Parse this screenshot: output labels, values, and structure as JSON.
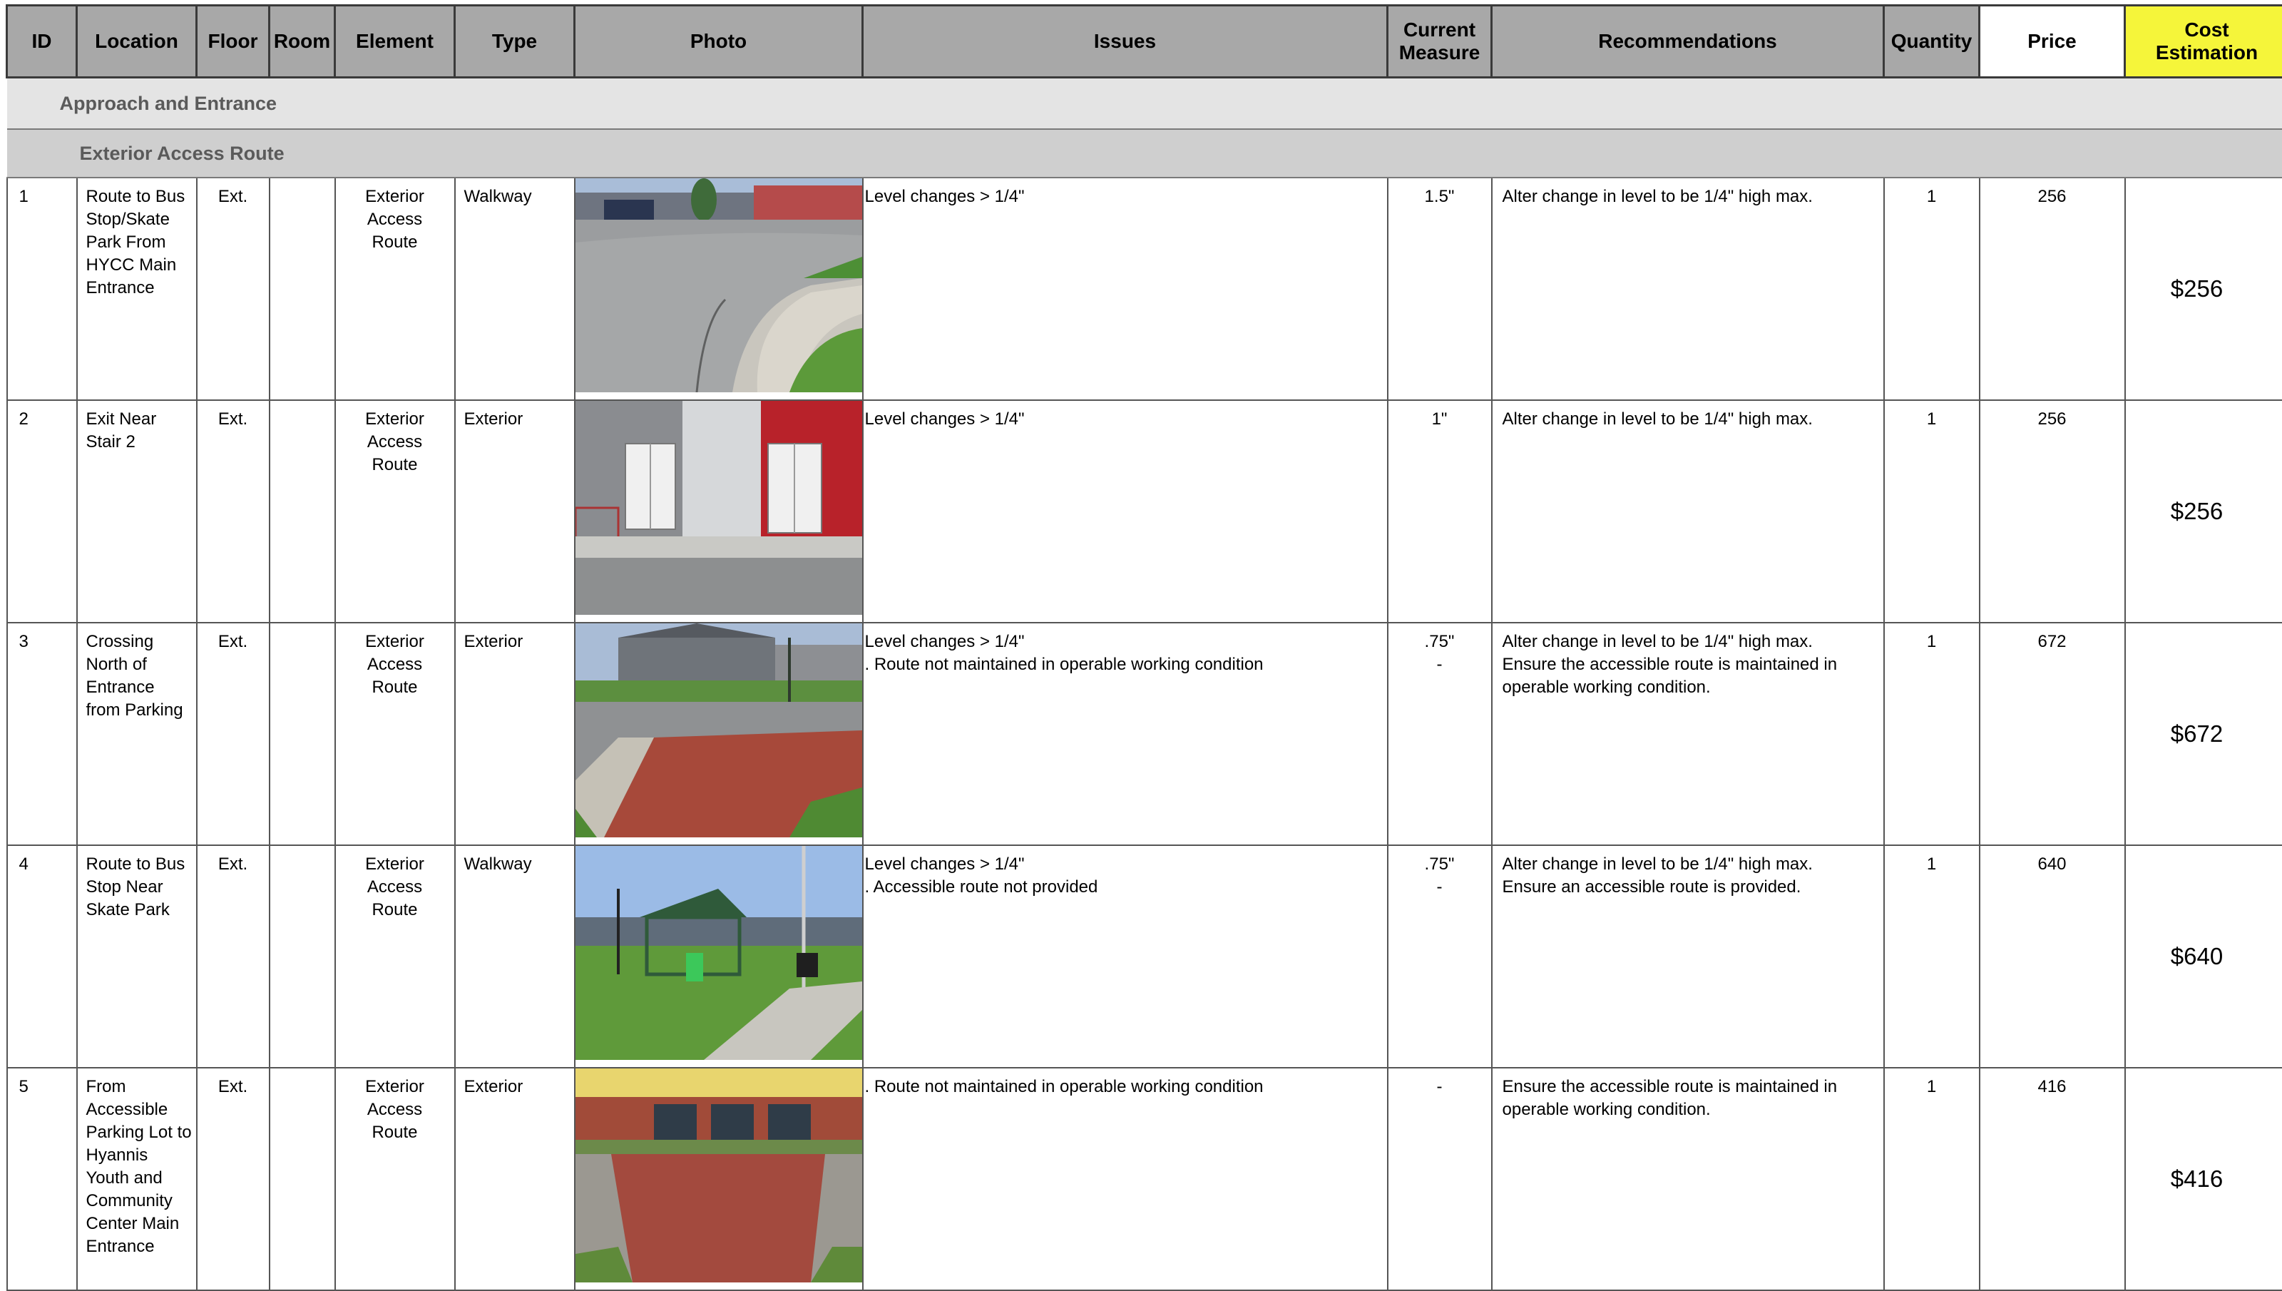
{
  "headers": {
    "id": "ID",
    "location": "Location",
    "floor": "Floor",
    "room": "Room",
    "element": "Element",
    "type": "Type",
    "photo": "Photo",
    "issues": "Issues",
    "measure_line1": "Current",
    "measure_line2": "Measure",
    "recommendations": "Recommendations",
    "quantity": "Quantity",
    "price": "Price",
    "cost_line1": "Cost",
    "cost_line2": "Estimation"
  },
  "colors": {
    "header_bg": "#a8a8a8",
    "cost_header_bg": "#f5f53a",
    "section_bg": "#e4e4e4",
    "subsection_bg": "#cfcfcf"
  },
  "section": "Approach and Entrance",
  "subsection": "Exterior Access Route",
  "rows": [
    {
      "id": "1",
      "location": [
        "Route to Bus",
        "Stop/Skate",
        "Park From",
        "HYCC Main",
        "Entrance"
      ],
      "floor": "Ext.",
      "room": "",
      "element": [
        "Exterior",
        "Access",
        "Route"
      ],
      "type": "Walkway",
      "photo": "photo-curb-walkway",
      "issues": [
        "Level changes > 1/4\""
      ],
      "measure": [
        "1.5\""
      ],
      "recommendations": [
        "Alter change in level to be 1/4\" high max."
      ],
      "quantity": "1",
      "price": "256",
      "cost": "$256"
    },
    {
      "id": "2",
      "location": [
        "Exit Near",
        "Stair 2"
      ],
      "floor": "Ext.",
      "room": "",
      "element": [
        "Exterior",
        "Access",
        "Route"
      ],
      "type": "Exterior",
      "photo": "photo-exit-doors",
      "issues": [
        "Level changes > 1/4\""
      ],
      "measure": [
        "1\""
      ],
      "recommendations": [
        "Alter change in level to be 1/4\" high max."
      ],
      "quantity": "1",
      "price": "256",
      "cost": "$256"
    },
    {
      "id": "3",
      "location": [
        "Crossing",
        "North of",
        "Entrance",
        "from Parking"
      ],
      "floor": "Ext.",
      "room": "",
      "element": [
        "Exterior",
        "Access",
        "Route"
      ],
      "type": "Exterior",
      "photo": "photo-brick-crossing",
      "issues": [
        "Level changes > 1/4\"",
        ". Route not maintained in operable working condition"
      ],
      "measure": [
        ".75\"",
        "-"
      ],
      "recommendations": [
        "Alter change in level to be 1/4\" high max.",
        "Ensure the accessible route is maintained in",
        "operable working condition."
      ],
      "quantity": "1",
      "price": "672",
      "cost": "$672"
    },
    {
      "id": "4",
      "location": [
        "Route to Bus",
        "Stop Near",
        "Skate Park"
      ],
      "floor": "Ext.",
      "room": "",
      "element": [
        "Exterior",
        "Access",
        "Route"
      ],
      "type": "Walkway",
      "photo": "photo-bus-shelter",
      "issues": [
        "Level changes > 1/4\"",
        ". Accessible route not provided"
      ],
      "measure": [
        ".75\"",
        "-"
      ],
      "recommendations": [
        "Alter change in level to be 1/4\" high max.",
        "Ensure an accessible route is provided."
      ],
      "quantity": "1",
      "price": "640",
      "cost": "$640"
    },
    {
      "id": "5",
      "location": [
        "From",
        "Accessible",
        "Parking Lot to",
        "Hyannis",
        "Youth and",
        "Community",
        "Center Main",
        "Entrance"
      ],
      "floor": "Ext.",
      "room": "",
      "element": [
        "Exterior",
        "Access",
        "Route"
      ],
      "type": "Exterior",
      "photo": "photo-brick-walk-entrance",
      "issues": [
        ". Route not maintained in operable working condition"
      ],
      "measure": [
        "-"
      ],
      "recommendations": [
        "Ensure the accessible route is maintained in",
        "operable working condition."
      ],
      "quantity": "1",
      "price": "416",
      "cost": "$416"
    }
  ]
}
